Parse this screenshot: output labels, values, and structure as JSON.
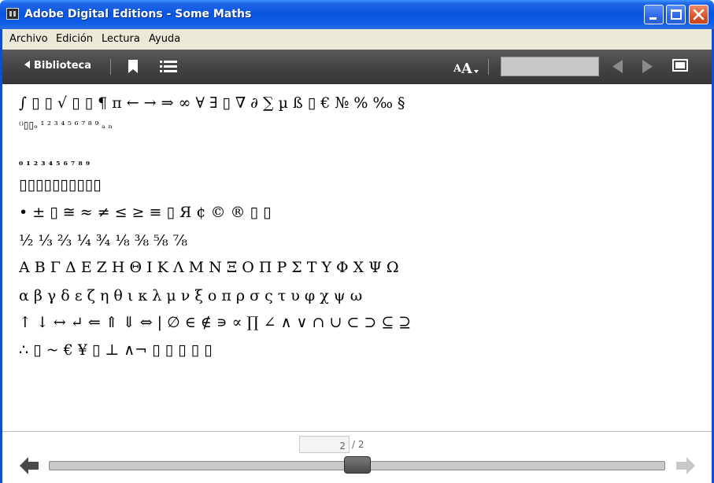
{
  "window": {
    "title": "Adobe Digital Editions - Some Maths"
  },
  "menu": {
    "items": [
      "Archivo",
      "Edición",
      "Lectura",
      "Ayuda"
    ]
  },
  "toolbar": {
    "library_label": "Biblioteca",
    "search_value": "",
    "icons": [
      "bookmark-icon",
      "table-of-contents-icon",
      "font-size-icon",
      "previous-page-icon",
      "next-page-icon",
      "fullscreen-icon"
    ]
  },
  "content": {
    "lines": [
      "∫ ▯ ▯ √ ▯ ▯ ¶ π ← → ⇒ ∞ ∀ ∃ ▯ ∇ ∂ ∑ µ ß ▯ € № % ‰ §",
      "⁽⁾▯▯ₒ ¹ ² ³ ⁴ ⁵ ⁶ ⁷ ⁸ ⁹ ₐ ₙ",
      "₀ ₁ ₂ ₃ ₄ ₅ ₆ ₇ ₈ ₉",
      "▯▯▯▯▯▯▯▯▯▯",
      "• ± ▯ ≅ ≈ ≠ ≤ ≥ ≡ ▯ Я ¢ © ® ▯ ▯",
      "½ ⅓ ⅔ ¼ ¾ ⅛ ⅜ ⅝ ⅞",
      "Α Β Γ Δ Ε Ζ Η Θ Ι Κ Λ Μ Ν Ξ Ο Π Ρ Σ Τ Υ Φ Χ Ψ Ω",
      "α β γ δ ε ζ η θ ι κ λ μ ν ξ ο π ρ σ ς τ υ φ χ ψ ω",
      "↑ ↓ ↔ ↵ ⇐ ⇑ ⇓ ⇔ | ∅ ∈ ∉ ∍ ∝ ∏ ∠ ∧ ∨ ∩ ∪ ⊂ ⊃ ⊆ ⊇",
      " ∴ ▯ ~ € ¥ ▯ ⊥ ∧¬ ▯ ▯ ▯ ▯ ▯"
    ]
  },
  "pager": {
    "current_page": "2",
    "total_label": "/ 2",
    "position_fraction": 0.5
  },
  "colors": {
    "titlebar_blue": "#0a55df",
    "toolbar_dark": "#444444",
    "menu_bg": "#ece9d8"
  }
}
